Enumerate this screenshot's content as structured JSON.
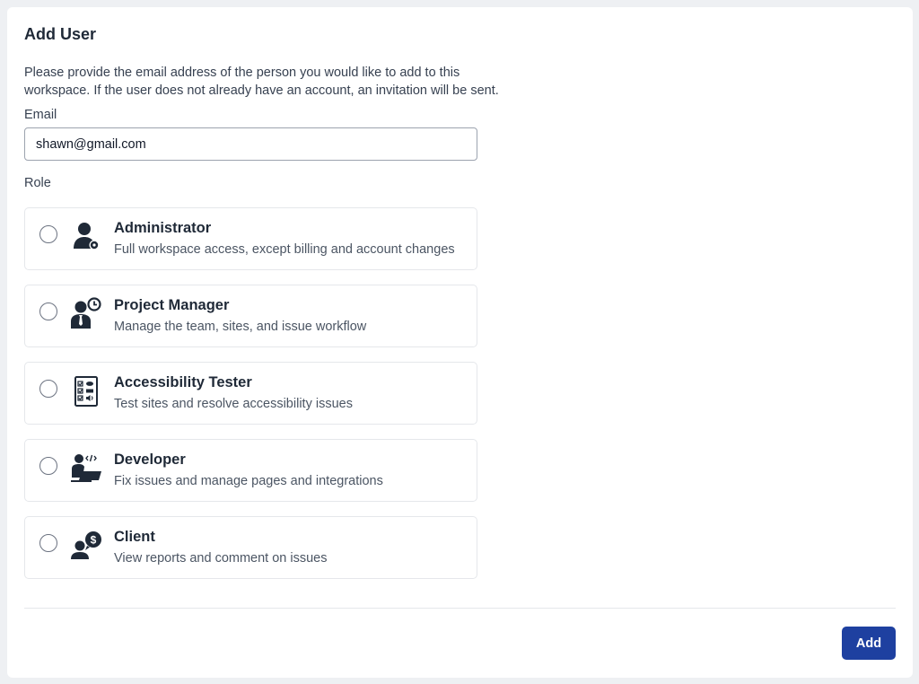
{
  "dialog": {
    "title": "Add User",
    "description": "Please provide the email address of the person you would like to add to this workspace. If the user does not already have an account, an invitation will be sent.",
    "email_label": "Email",
    "email_value": "shawn@gmail.com",
    "role_label": "Role",
    "add_label": "Add"
  },
  "roles": [
    {
      "name": "Administrator",
      "description": "Full workspace access, except billing and account changes",
      "icon": "admin-user-gear-icon",
      "selected": false
    },
    {
      "name": "Project Manager",
      "description": "Manage the team, sites, and issue workflow",
      "icon": "manager-clock-icon",
      "selected": false
    },
    {
      "name": "Accessibility Tester",
      "description": "Test sites and resolve accessibility issues",
      "icon": "checklist-icon",
      "selected": false
    },
    {
      "name": "Developer",
      "description": "Fix issues and manage pages and integrations",
      "icon": "developer-laptop-code-icon",
      "selected": false
    },
    {
      "name": "Client",
      "description": "View reports and comment on issues",
      "icon": "client-dollar-icon",
      "selected": false
    }
  ],
  "colors": {
    "primary_button": "#1e40a0",
    "icon": "#1f2937"
  }
}
